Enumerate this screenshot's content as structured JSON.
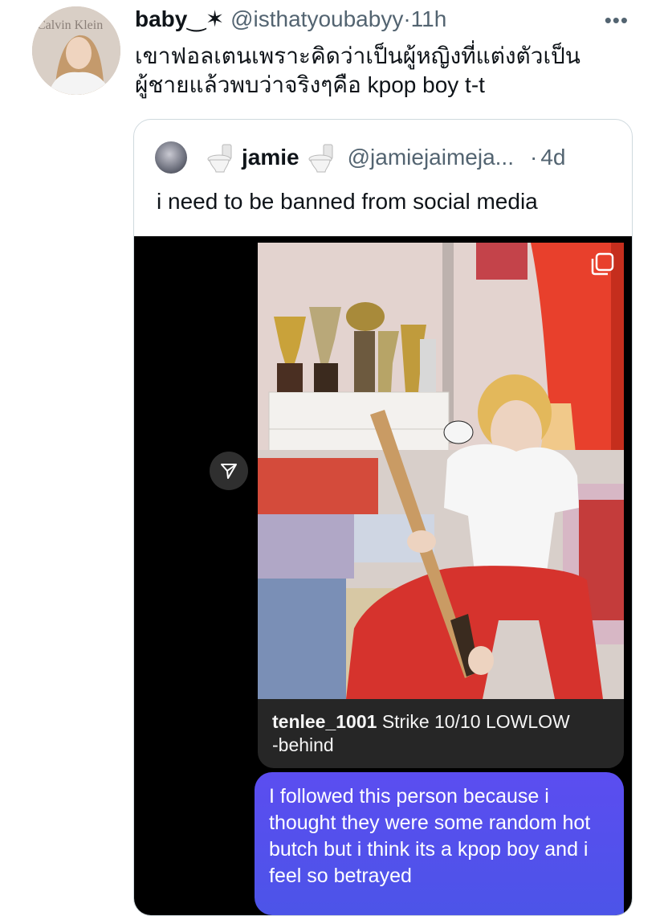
{
  "tweet": {
    "display_name": "baby",
    "name_decoration": "‿✶",
    "handle": "@isthatyoubabyy",
    "separator": "·",
    "time": "11h",
    "text_line1": "เขาฟอลเตนเพราะคิดว่าเป็นผู้หญิงที่แต่งตัวเป็น",
    "text_line2": "ผู้ชายแล้วพบว่าจริงๆคือ kpop boy t-t",
    "avatar_logo": "Calvin Klein"
  },
  "quoted_tweet": {
    "display_name": "jamie",
    "handle": "@jamiejaimeja...",
    "separator": "·",
    "time": "4d",
    "text": "i need to be banned from social media"
  },
  "screenshot": {
    "caption_user": "tenlee_1001",
    "caption_text": "Strike 10/10 LOWLOW",
    "caption_text2": "-behind",
    "dm_message": "I followed this person because i thought they were some random hot butch but i think its a kpop boy and i feel so betrayed"
  },
  "colors": {
    "secondary_text": "#536471",
    "dm_bubble": "#5b4df0",
    "caption_bg": "#262626"
  },
  "icons": [
    "more-icon",
    "toilet-icon",
    "share-icon",
    "multi-photo-icon"
  ]
}
